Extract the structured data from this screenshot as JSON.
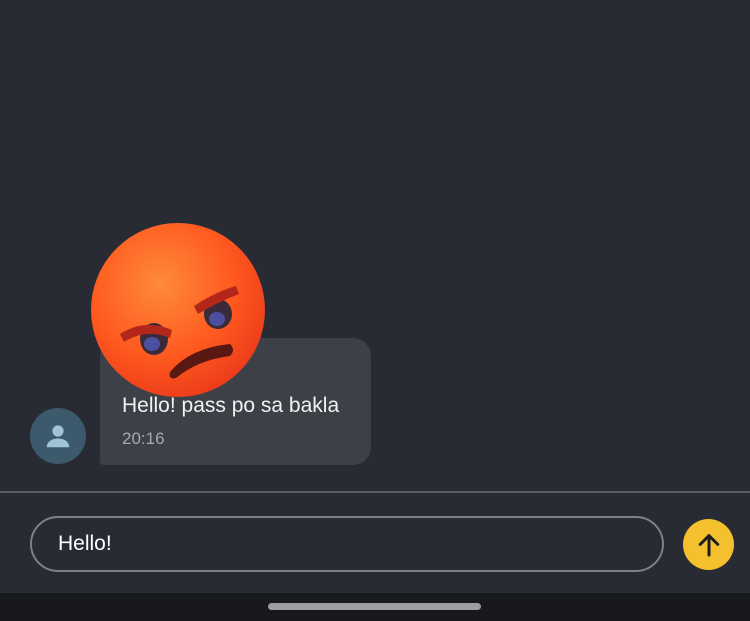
{
  "message": {
    "sender_visible": "a",
    "text": "Hello! pass po sa bakla",
    "time": "20:16"
  },
  "overlay": {
    "emoji": "angry-face-emoji"
  },
  "composer": {
    "input_value": "Hello!"
  },
  "icons": {
    "avatar": "person-icon",
    "send": "arrow-up-icon"
  },
  "colors": {
    "background": "#282b33",
    "bubble": "#3d4047",
    "send_button": "#f5c02d",
    "avatar_bg": "#3c5a6b"
  }
}
